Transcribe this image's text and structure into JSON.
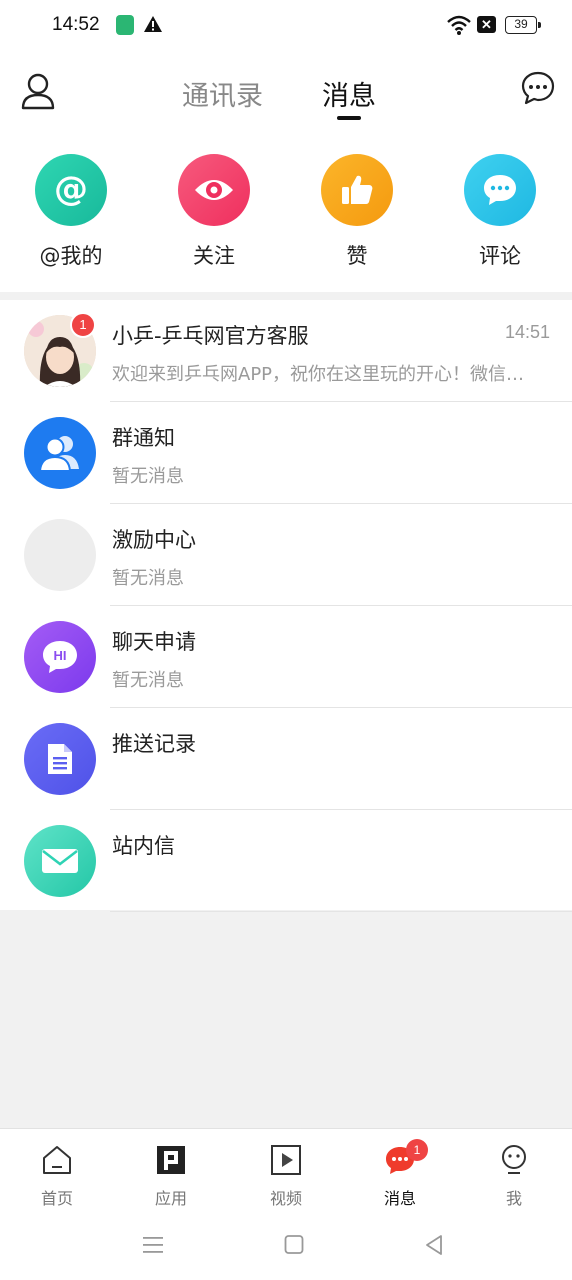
{
  "status_bar": {
    "time": "14:52",
    "battery": "39"
  },
  "header": {
    "tabs": [
      {
        "label": "通讯录",
        "active": false
      },
      {
        "label": "消息",
        "active": true
      }
    ]
  },
  "quick_actions": [
    {
      "label": "@我的",
      "icon": "at-icon",
      "color": "#22c7a9"
    },
    {
      "label": "关注",
      "icon": "eye-icon",
      "color": "#f43f6c"
    },
    {
      "label": "赞",
      "icon": "thumbs-up-icon",
      "color": "#f7a41d"
    },
    {
      "label": "评论",
      "icon": "comment-icon",
      "color": "#2cc5ea"
    }
  ],
  "conversations": [
    {
      "title": "小乒-乒乓网官方客服",
      "subtitle": "欢迎来到乒乓网APP，祝你在这里玩的开心！微信交流群...",
      "time": "14:51",
      "badge": "1"
    },
    {
      "title": "群通知",
      "subtitle": "暂无消息"
    },
    {
      "title": "激励中心",
      "subtitle": "暂无消息"
    },
    {
      "title": "聊天申请",
      "subtitle": "暂无消息",
      "avatar_text": "HI"
    },
    {
      "title": "推送记录",
      "subtitle": ""
    },
    {
      "title": "站内信",
      "subtitle": ""
    }
  ],
  "bottom_nav": [
    {
      "label": "首页",
      "icon": "home-icon",
      "active": false
    },
    {
      "label": "应用",
      "icon": "apps-icon",
      "active": false
    },
    {
      "label": "视频",
      "icon": "video-icon",
      "active": false
    },
    {
      "label": "消息",
      "icon": "message-icon",
      "active": true,
      "badge": "1"
    },
    {
      "label": "我",
      "icon": "profile-icon",
      "active": false
    }
  ],
  "colors": {
    "accent_red": "#ef4444",
    "group_blue": "#1e7bf0",
    "chat_purple": "#8b4df0",
    "push_indigo": "#5b5ff0",
    "mail_teal": "#2fd3b4"
  }
}
